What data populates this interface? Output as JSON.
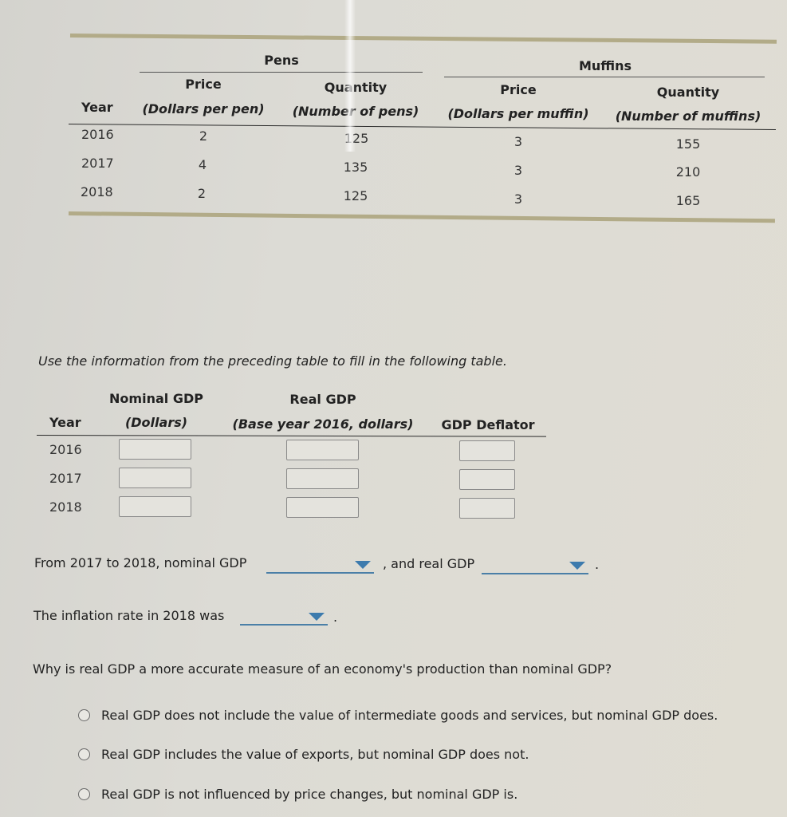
{
  "source_table": {
    "group_headers": {
      "pens": "Pens",
      "muffins": "Muffins"
    },
    "columns": {
      "year": "Year",
      "pen_price": {
        "title": "Price",
        "unit": "(Dollars per pen)"
      },
      "pen_quantity": {
        "title": "Quantity",
        "unit": "(Number of pens)"
      },
      "muffin_price": {
        "title": "Price",
        "unit": "(Dollars per muffin)"
      },
      "muffin_quantity": {
        "title": "Quantity",
        "unit": "(Number of muffins)"
      }
    },
    "rows": [
      {
        "year": "2016",
        "pen_price": "2",
        "pen_quantity": "125",
        "muffin_price": "3",
        "muffin_quantity": "155"
      },
      {
        "year": "2017",
        "pen_price": "4",
        "pen_quantity": "135",
        "muffin_price": "3",
        "muffin_quantity": "210"
      },
      {
        "year": "2018",
        "pen_price": "2",
        "pen_quantity": "125",
        "muffin_price": "3",
        "muffin_quantity": "165"
      }
    ]
  },
  "instruction": "Use the information from the preceding table to fill in the following table.",
  "gdp_table": {
    "columns": {
      "year": "Year",
      "nominal": {
        "title": "Nominal GDP",
        "unit": "(Dollars)"
      },
      "real": {
        "title": "Real GDP",
        "unit": "(Base year 2016, dollars)"
      },
      "deflator": "GDP Deflator"
    },
    "rows": [
      {
        "year": "2016",
        "nominal": "",
        "real": "",
        "deflator": ""
      },
      {
        "year": "2017",
        "nominal": "",
        "real": "",
        "deflator": ""
      },
      {
        "year": "2018",
        "nominal": "",
        "real": "",
        "deflator": ""
      }
    ]
  },
  "sentence1": {
    "prefix": "From 2017 to 2018, nominal GDP",
    "middle": ", and real GDP",
    "suffix": ".",
    "dropdown1_value": "",
    "dropdown2_value": ""
  },
  "sentence2": {
    "prefix": "The inflation rate in 2018 was",
    "suffix": ".",
    "dropdown_value": ""
  },
  "question": {
    "text": "Why is real GDP a more accurate measure of an economy's production than nominal GDP?",
    "options": [
      "Real GDP does not include the value of intermediate goods and services, but nominal GDP does.",
      "Real GDP includes the value of exports, but nominal GDP does not.",
      "Real GDP is not influenced by price changes, but nominal GDP is."
    ]
  },
  "colors": {
    "table_bar": "#b2ab88",
    "dropdown_accent": "#3d7bad"
  }
}
